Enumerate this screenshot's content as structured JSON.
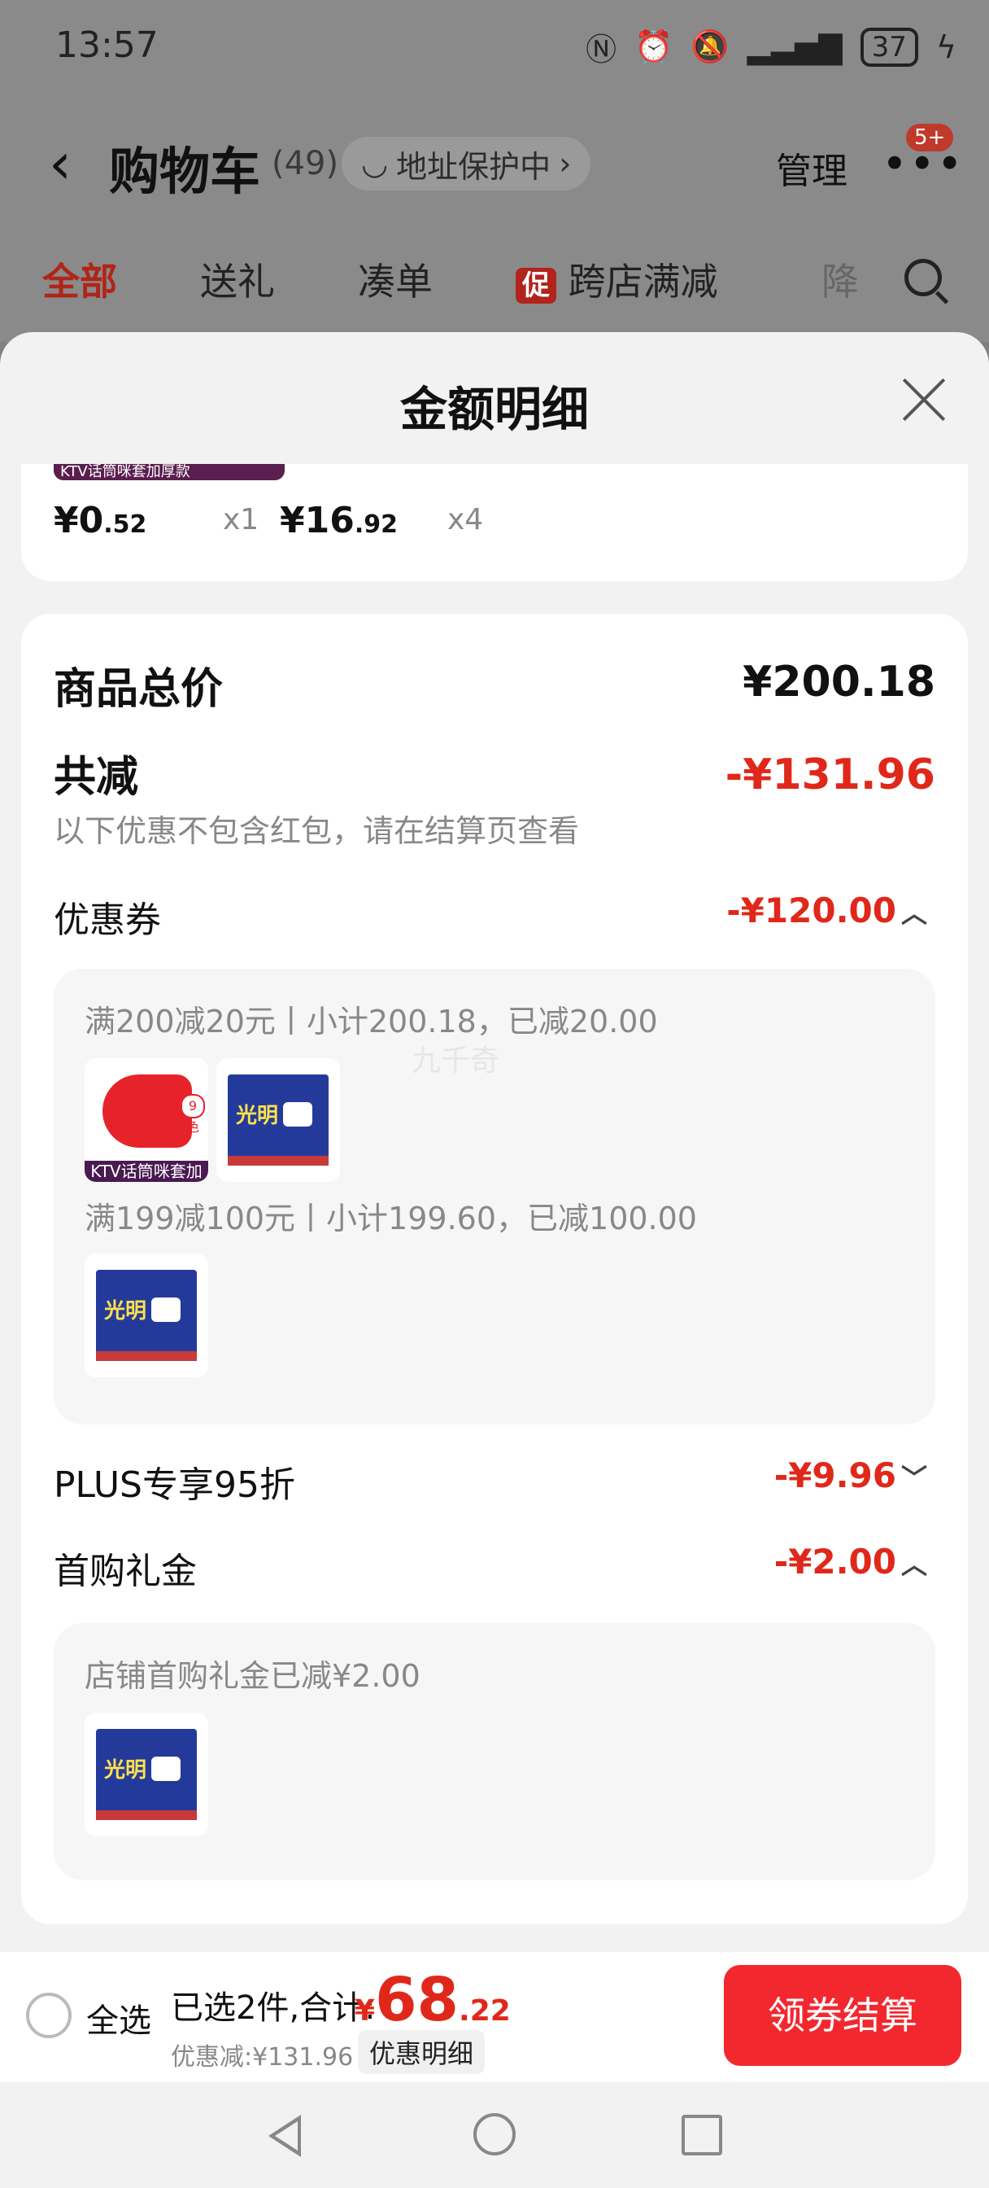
{
  "status_bar": {
    "time": "13:57",
    "battery": "37"
  },
  "header": {
    "title": "购物车",
    "count": "(49)",
    "address_protect": "地址保护中",
    "manage": "管理",
    "more_badge": "5+"
  },
  "tabs": [
    {
      "label": "全部",
      "active": true
    },
    {
      "label": "送礼"
    },
    {
      "label": "凑单"
    },
    {
      "label": "跨店满减",
      "tag": "促"
    },
    {
      "label": "降"
    }
  ],
  "sheet": {
    "title": "金额明细",
    "top_items": [
      {
        "price_int": "¥0",
        "price_dec": ".52",
        "qty": "x1"
      },
      {
        "price_int": "¥16",
        "price_dec": ".92",
        "qty": "x4"
      }
    ],
    "top_item_label": "KTV话筒咪套加厚款",
    "total_label": "商品总价",
    "total_value": "¥200.18",
    "discount_label": "共减",
    "discount_value": "-¥131.96",
    "discount_note": "以下优惠不包含红包，请在结算页查看",
    "coupon": {
      "label": "优惠券",
      "value": "-¥120.00",
      "groups": [
        {
          "text": "满200减20元丨小计200.18，已减20.00"
        },
        {
          "text": "满199减100元丨小计199.60，已减100.00"
        }
      ]
    },
    "watermark": "九千奇",
    "mic_label": "KTV话筒咪套加厚款",
    "mic_badge": "9色",
    "box_brand": "光明",
    "plus": {
      "label": "PLUS专享95折",
      "value": "-¥9.96"
    },
    "first_gift": {
      "label": "首购礼金",
      "value": "-¥2.00",
      "text": "店铺首购礼金已减¥2.00"
    }
  },
  "bottom_bar": {
    "select_all": "全选",
    "selected_summary": "已选2件,合计:",
    "total_symbol": "¥",
    "total_int": "68",
    "total_dec": ".22",
    "discount_text": "优惠减:¥131.96",
    "details_button": "优惠明细",
    "checkout_button": "领券结算"
  }
}
